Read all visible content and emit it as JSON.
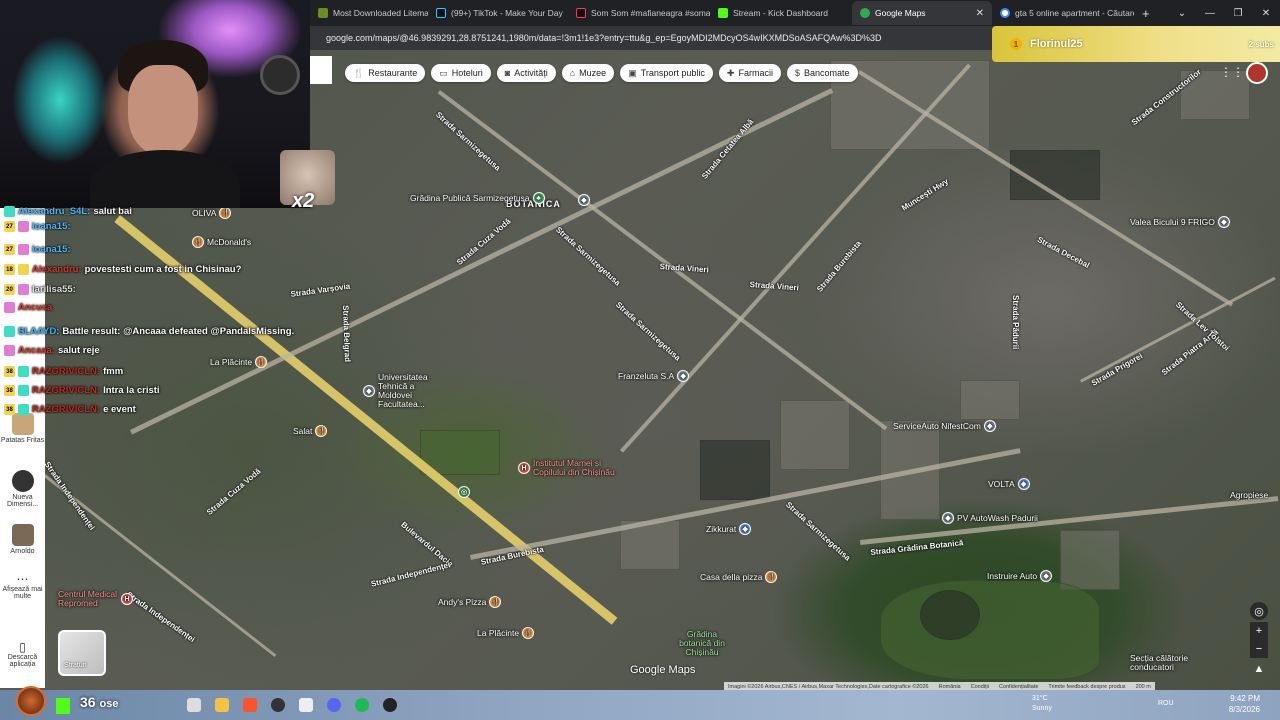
{
  "browser": {
    "tabs": [
      {
        "label": "Most Downloaded Litematica | M",
        "color": "#6b8e23"
      },
      {
        "label": "(99+) TikTok - Make Your Day",
        "color": "#111111"
      },
      {
        "label": "Som Som #mafianeagra #soman",
        "color": "#111111"
      },
      {
        "label": "Stream - Kick Dashboard",
        "color": "#53fc18"
      },
      {
        "label": "Google Maps",
        "color": "#34a853",
        "active": true
      },
      {
        "label": "gta 5 online apartment - Căutare",
        "color": "#4285f4"
      }
    ],
    "new_tab_label": "+",
    "url": "google.com/maps/@46.9839291,28.8751241,1980m/data=!3m1!1e3?entry=ttu&g_ep=EgoyMDI2MDcyOS4wIKXMDSoASAFQAw%3D%3D"
  },
  "stream": {
    "banner_name": "Florinul25",
    "banner_subs": "2 subs",
    "viewers": "36",
    "viewers_suffix": "ose",
    "emote_multiplier": "x2"
  },
  "maps": {
    "chips": [
      {
        "icon": "fork-knife-icon",
        "glyph": "🍴",
        "label": "Restaurante"
      },
      {
        "icon": "bed-icon",
        "glyph": "▭",
        "label": "Hoteluri"
      },
      {
        "icon": "camera-icon",
        "glyph": "◙",
        "label": "Activități"
      },
      {
        "icon": "museum-icon",
        "glyph": "⌂",
        "label": "Muzee"
      },
      {
        "icon": "transit-icon",
        "glyph": "▣",
        "label": "Transport public"
      },
      {
        "icon": "pharmacy-icon",
        "glyph": "✚",
        "label": "Farmacii"
      },
      {
        "icon": "atm-icon",
        "glyph": "$",
        "label": "Bancomate"
      }
    ],
    "layers_label": "Straturi",
    "logo": "Google Maps",
    "attribution": [
      "Imagini ©2026 Airbus,CNES / Airbus,Maxar Technologies,Date cartografice ©2026",
      "România",
      "Condiții",
      "Confidențialitate",
      "Trimite feedback despre produs",
      "200 m"
    ],
    "area_label": "BOTANICA",
    "pois": [
      {
        "label": "Grădina Publică Sarmizegetusa",
        "type": "park"
      },
      {
        "label": "McDonald's",
        "type": "food"
      },
      {
        "label": "OLIVA",
        "type": "food"
      },
      {
        "label": "La Plăcinte",
        "type": "food"
      },
      {
        "label": "Salat",
        "type": "food"
      },
      {
        "label": "Universitatea Tehnică a Moldovei Facultatea...",
        "type": "gov"
      },
      {
        "label": "Franzeluta S.A",
        "type": "gov"
      },
      {
        "label": "Institutul Mamei și Copilului din Chișinău",
        "type": "med"
      },
      {
        "label": "Zikkurat",
        "type": "shop"
      },
      {
        "label": "Casa della pizza",
        "type": "food"
      },
      {
        "label": "Andy's Pizza",
        "type": "food"
      },
      {
        "label": "La Plăcinte",
        "type": "food"
      },
      {
        "label": "Centrul Medical Repromed",
        "type": "med"
      },
      {
        "label": "Grădina botanică din Chișinău",
        "type": "park"
      },
      {
        "label": "ServiceAuto NifestCom",
        "type": "gov"
      },
      {
        "label": "VOLTA",
        "type": "shop"
      },
      {
        "label": "PV AutoWash Padurii",
        "type": "gov"
      },
      {
        "label": "Instruire Auto",
        "type": "gov"
      },
      {
        "label": "Valea Bicului 9 FRIGO",
        "type": "gov"
      },
      {
        "label": "Secția călătorie conducatori",
        "type": "gov"
      },
      {
        "label": "Agropiese",
        "type": "shop"
      }
    ],
    "streets": [
      "Strada Sarmizegetusa",
      "Strada Cuza Vodă",
      "Bulevardul Dacia",
      "Strada Burebista",
      "Strada Independenței",
      "Strada Grădina Botanică",
      "Strada Vissarion",
      "Strada Teilor",
      "Strada Pădurii",
      "Strada Pandurilor",
      "Strada Varșovia",
      "Strada Cetatea Albă",
      "Strada Hristo Botev",
      "Muncești Hwy",
      "Strada Belgrad",
      "Strada Vasile Lupu",
      "Strada Decebal",
      "Strada Vineri",
      "Strada Prigorei",
      "Strada Lev Tolstoi",
      "Strada Constructorilor",
      "Strada Piatra Arsă",
      "Strada Sarmizegetusa"
    ]
  },
  "rail": {
    "items": [
      {
        "label": "Patatas Fritas"
      },
      {
        "label": "Nueva Dimensi..."
      },
      {
        "label": "Arnoldo"
      },
      {
        "label": "Afișează mai multe"
      },
      {
        "label": "Descarcă aplicația"
      }
    ]
  },
  "chat": [
    {
      "user": "Alexandru_S4L:",
      "text": "salut bai",
      "color": "#4ab7ff",
      "level": "",
      "badge": "#3be0c4"
    },
    {
      "user": "ioana15:",
      "text": "",
      "color": "#4ab7ff",
      "level": "27",
      "badge": "#e27dd6"
    },
    {
      "user": "ioana15:",
      "text": "",
      "color": "#4ab7ff",
      "level": "27",
      "badge": "#e27dd6"
    },
    {
      "user": "Alexandru:",
      "text": "povestesti cum a fost in Chisinau?",
      "color": "#d6372b",
      "level": "18",
      "badge": "#f3d34a"
    },
    {
      "user": "larilisa55:",
      "text": "",
      "color": "#e0e0e0",
      "level": "20",
      "badge": "#e27dd6"
    },
    {
      "user": "Ancuca",
      "text": "",
      "color": "#d6372b",
      "level": "",
      "badge": "#e27dd6"
    },
    {
      "user": "SLAAYD:",
      "text": "Battle result: @Ancaaa defeated @PandalsMissing.",
      "color": "#3bb3ff",
      "level": "",
      "badge": "#3be0c4"
    },
    {
      "user": "Ancaaa:",
      "text": "salut reje",
      "color": "#d6372b",
      "level": "",
      "badge": "#e27dd6"
    },
    {
      "user": "RAZGRIVICLN:",
      "text": "fmm",
      "color": "#c0281f",
      "level": "38",
      "badge": "#3be0c4"
    },
    {
      "user": "RAZGRIVICLN:",
      "text": "Intra la cristi",
      "color": "#c0281f",
      "level": "38",
      "badge": "#3be0c4"
    },
    {
      "user": "RAZGRIVICLN:",
      "text": "e event",
      "color": "#c0281f",
      "level": "38",
      "badge": "#3be0c4"
    }
  ],
  "taskbar": {
    "weather_temp": "31°C",
    "weather_desc": "Sunny",
    "lang": "ROU",
    "time": "9:42 PM",
    "date": "8/3/2026"
  }
}
